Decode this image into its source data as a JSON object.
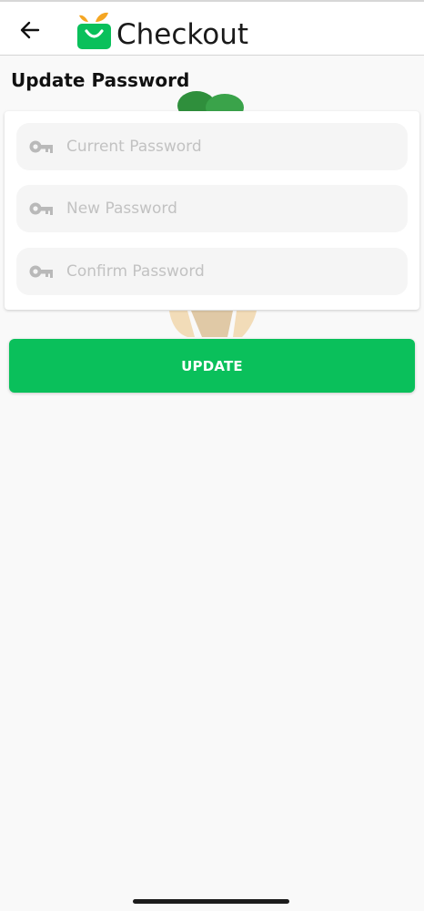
{
  "header": {
    "back_icon": "arrow-left-icon",
    "logo_text": "Checkout",
    "logo_colors": {
      "bag": "#0ac05b",
      "leaves": "#f5a623"
    }
  },
  "page": {
    "title": "Update Password"
  },
  "form": {
    "current_password": {
      "placeholder": "Current Password",
      "value": "",
      "icon": "key-icon"
    },
    "new_password": {
      "placeholder": "New Password",
      "value": "",
      "icon": "key-icon"
    },
    "confirm_password": {
      "placeholder": "Confirm Password",
      "value": "",
      "icon": "key-icon"
    },
    "submit_label": "UPDATE"
  },
  "colors": {
    "accent": "#0ac05b",
    "background": "#f9f9f9",
    "field_bg": "#f5f5f5",
    "placeholder": "#c2c2c2"
  }
}
